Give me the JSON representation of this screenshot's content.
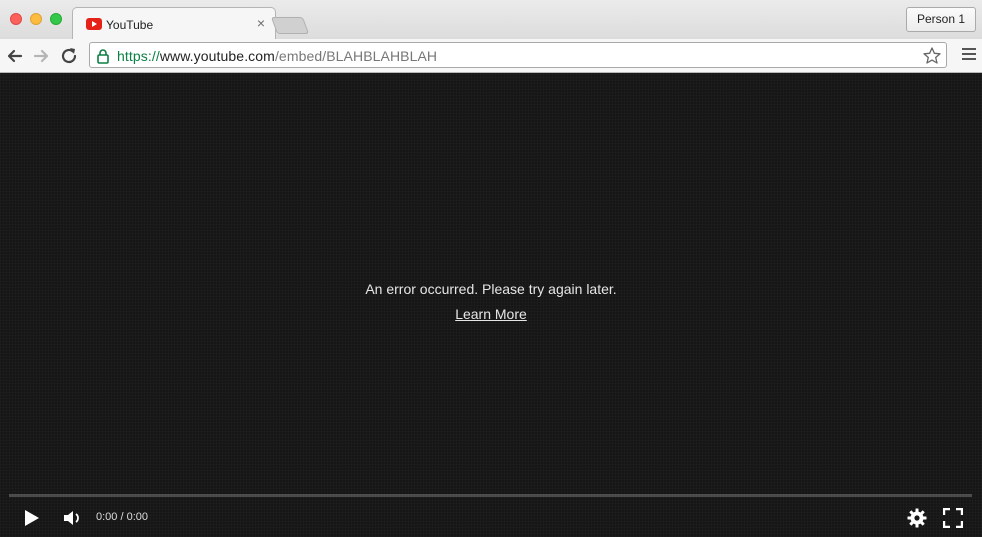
{
  "tab": {
    "title": "YouTube",
    "close_glyph": "×",
    "favicon": "youtube-favicon-icon"
  },
  "profile": {
    "label": "Person 1"
  },
  "address_bar": {
    "scheme": "https://",
    "host": "www.youtube.com",
    "path": "/embed/BLAHBLAHBLAH"
  },
  "player": {
    "error_message": "An error occurred. Please try again later.",
    "learn_more": "Learn More",
    "time": "0:00 / 0:00"
  },
  "colors": {
    "secure_green": "#0b8043",
    "youtube_red": "#e62117",
    "player_bg": "#161616"
  }
}
